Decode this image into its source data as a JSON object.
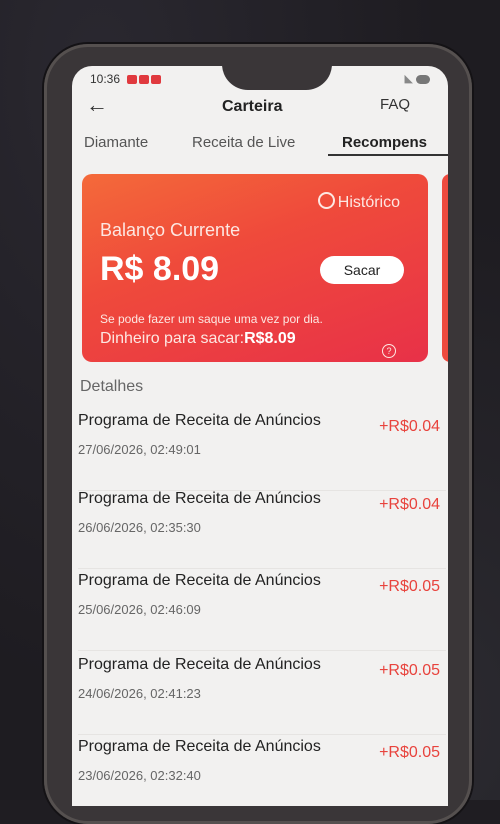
{
  "status": {
    "time": "10:36"
  },
  "header": {
    "back_label": "←",
    "title": "Carteira",
    "faq": "FAQ"
  },
  "tabs": [
    {
      "label": "Diamante"
    },
    {
      "label": "Receita de Live"
    },
    {
      "label": "Recompens"
    }
  ],
  "card": {
    "history_label": "Histórico",
    "balance_label": "Balanço Currente",
    "balance_amount": "R$ 8.09",
    "withdraw_button": "Sacar",
    "rule_text": "Se pode fazer um saque uma vez por dia.",
    "available_label": "Dinheiro para sacar:",
    "available_amount": "R$8.09",
    "help_symbol": "?"
  },
  "details": {
    "label": "Detalhes",
    "items": [
      {
        "name": "Programa de Receita de Anúncios",
        "amount": "+R$0.04",
        "date": "27/06/2026, 02:49:01"
      },
      {
        "name": "Programa de Receita de Anúncios",
        "amount": "+R$0.04",
        "date": "26/06/2026, 02:35:30"
      },
      {
        "name": "Programa de Receita de Anúncios",
        "amount": "+R$0.05",
        "date": "25/06/2026, 02:46:09"
      },
      {
        "name": "Programa de Receita de Anúncios",
        "amount": "+R$0.05",
        "date": "24/06/2026, 02:41:23"
      },
      {
        "name": "Programa de Receita de Anúncios",
        "amount": "+R$0.05",
        "date": "23/06/2026, 02:32:40"
      }
    ]
  }
}
